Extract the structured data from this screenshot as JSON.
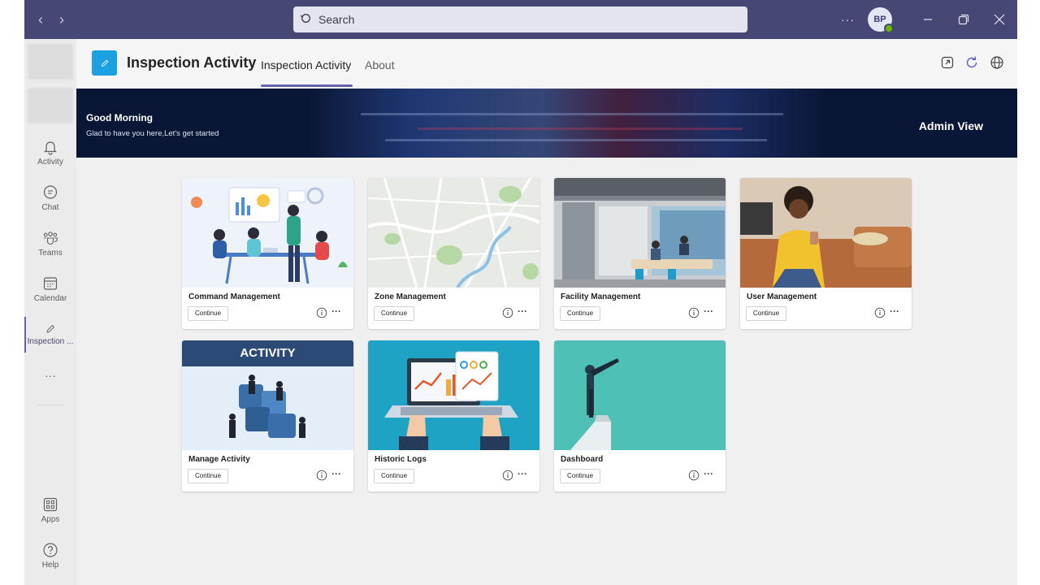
{
  "titlebar": {
    "search_placeholder": "Search",
    "more": "···",
    "avatar_initials": "BP"
  },
  "rail": {
    "items": [
      {
        "label": "Activity",
        "icon": "bell-icon"
      },
      {
        "label": "Chat",
        "icon": "chat-icon"
      },
      {
        "label": "Teams",
        "icon": "teams-icon"
      },
      {
        "label": "Calendar",
        "icon": "calendar-icon"
      },
      {
        "label": "Inspection ...",
        "icon": "pencil-icon"
      },
      {
        "label": "Apps",
        "icon": "apps-icon"
      },
      {
        "label": "Help",
        "icon": "help-icon"
      }
    ],
    "more": "···"
  },
  "app": {
    "title": "Inspection Activity",
    "tabs": [
      {
        "label": "Inspection Activity",
        "active": true
      },
      {
        "label": "About",
        "active": false
      }
    ]
  },
  "banner": {
    "greeting": "Good Morning",
    "subtitle": "Glad to have you here,Let's get started",
    "view": "Admin View"
  },
  "cards": [
    {
      "title": "Command Management",
      "button": "Continue",
      "more": "···"
    },
    {
      "title": "Zone Management",
      "button": "Continue",
      "more": "···"
    },
    {
      "title": "Facility Management",
      "button": "Continue",
      "more": "···"
    },
    {
      "title": "User Management",
      "button": "Continue",
      "more": "···"
    },
    {
      "title": "Manage Activity",
      "button": "Continue",
      "more": "···",
      "image_text": "ACTIVITY"
    },
    {
      "title": "Historic Logs",
      "button": "Continue",
      "more": "···"
    },
    {
      "title": "Dashboard",
      "button": "Continue",
      "more": "···"
    }
  ],
  "colors": {
    "titlebar": "#464775",
    "accent": "#6264a7",
    "banner": "#0a1636",
    "app_icon": "#1ba1e2"
  }
}
